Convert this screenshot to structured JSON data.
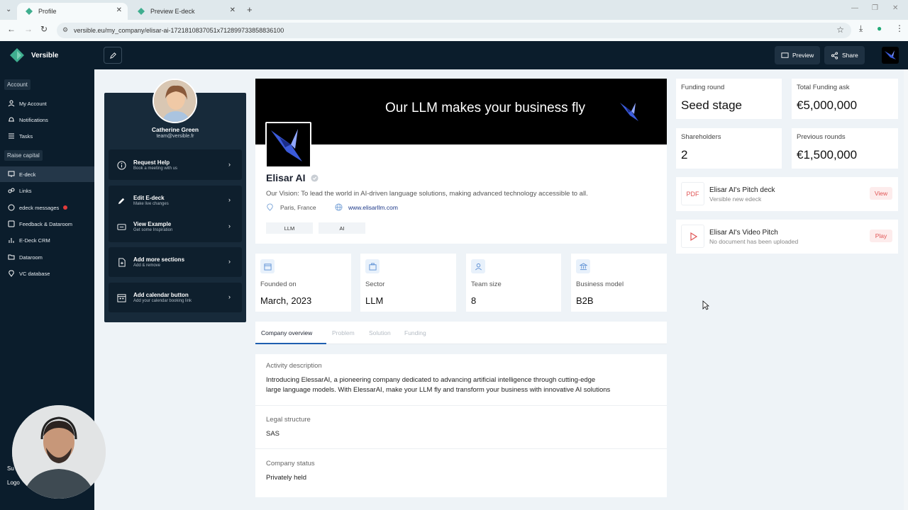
{
  "browser": {
    "tabs": [
      {
        "title": "Profile",
        "active": true
      },
      {
        "title": "Preview E-deck",
        "active": false
      }
    ],
    "url": "versible.eu/my_company/elisar-ai-1721810837051x712899733858836100"
  },
  "app": {
    "brand": "Versible",
    "accent": "#1f5fb0",
    "sidebar_bg": "#0b1d2c"
  },
  "sidebar": {
    "section_account": "Account",
    "section_raise": "Raise capital",
    "account_items": [
      {
        "label": "My Account",
        "icon": "user-icon"
      },
      {
        "label": "Notifications",
        "icon": "bell-icon"
      },
      {
        "label": "Tasks",
        "icon": "list-icon"
      }
    ],
    "raise_items": [
      {
        "label": "E-deck",
        "icon": "presentation-icon",
        "active": true
      },
      {
        "label": "Links",
        "icon": "link-icon"
      },
      {
        "label": "edeck messages",
        "icon": "message-icon",
        "badge": true
      },
      {
        "label": "Feedback & Dataroom",
        "icon": "feedback-icon"
      },
      {
        "label": "E-Deck CRM",
        "icon": "chart-icon"
      },
      {
        "label": "Dataroom",
        "icon": "folder-icon"
      },
      {
        "label": "VC database",
        "icon": "database-icon"
      }
    ],
    "partial_text_1": "Su",
    "partial_text_2": "Logo"
  },
  "topbar": {
    "preview_label": "Preview",
    "share_label": "Share"
  },
  "profile": {
    "name": "Catherine Green",
    "email": "team@versible.fr",
    "actions": [
      {
        "title": "Request Help",
        "subtitle": "Book a meeting with us",
        "icon": "help-icon"
      },
      {
        "title": "Edit E-deck",
        "subtitle": "Make live changes",
        "icon": "pencil-icon"
      },
      {
        "title": "View Example",
        "subtitle": "Get some Inspiration",
        "icon": "example-icon"
      },
      {
        "title": "Add more sections",
        "subtitle": "Add & remove",
        "icon": "add-file-icon"
      },
      {
        "title": "Add calendar button",
        "subtitle": "Add your calendar booking link",
        "icon": "calendar-icon"
      }
    ]
  },
  "company": {
    "banner_text": "Our LLM makes your business fly",
    "name": "Elisar AI",
    "vision": "Our Vision: To lead the world in AI-driven language solutions, making advanced technology accessible to all.",
    "location": "Paris, France",
    "website": "www.elisarllm.com",
    "tags": [
      "LLM",
      "AI"
    ]
  },
  "stats": [
    {
      "label": "Founded on",
      "value": "March, 2023",
      "icon": "calendar-icon"
    },
    {
      "label": "Sector",
      "value": "LLM",
      "icon": "briefcase-icon"
    },
    {
      "label": "Team size",
      "value": "8",
      "icon": "person-icon"
    },
    {
      "label": "Business model",
      "value": "B2B",
      "icon": "bank-icon"
    }
  ],
  "tabs": [
    "Company overview",
    "Problem",
    "Solution",
    "Funding"
  ],
  "overview": {
    "activity_label": "Activity description",
    "activity_line1": "Introducing ElessarAI, a pioneering company dedicated to advancing artificial intelligence through cutting-edge",
    "activity_line2": "large language models. With ElessarAI, make your LLM fly and transform your business with innovative AI solutions",
    "legal_label": "Legal structure",
    "legal_value": "SAS",
    "status_label": "Company status",
    "status_value": "Privately held"
  },
  "funding": {
    "round_label": "Funding round",
    "round_value": "Seed stage",
    "ask_label": "Total Funding ask",
    "ask_value": "€5,000,000",
    "shareholders_label": "Shareholders",
    "shareholders_value": "2",
    "previous_label": "Previous rounds",
    "previous_value": "€1,500,000"
  },
  "documents": [
    {
      "title": "Elisar AI's Pitch deck",
      "subtitle": "Versible new edeck",
      "action": "View",
      "icon_text": "PDF"
    },
    {
      "title": "Elisar AI's Video Pitch",
      "subtitle": "No document has been uploaded",
      "action": "Play",
      "icon_text": ""
    }
  ]
}
